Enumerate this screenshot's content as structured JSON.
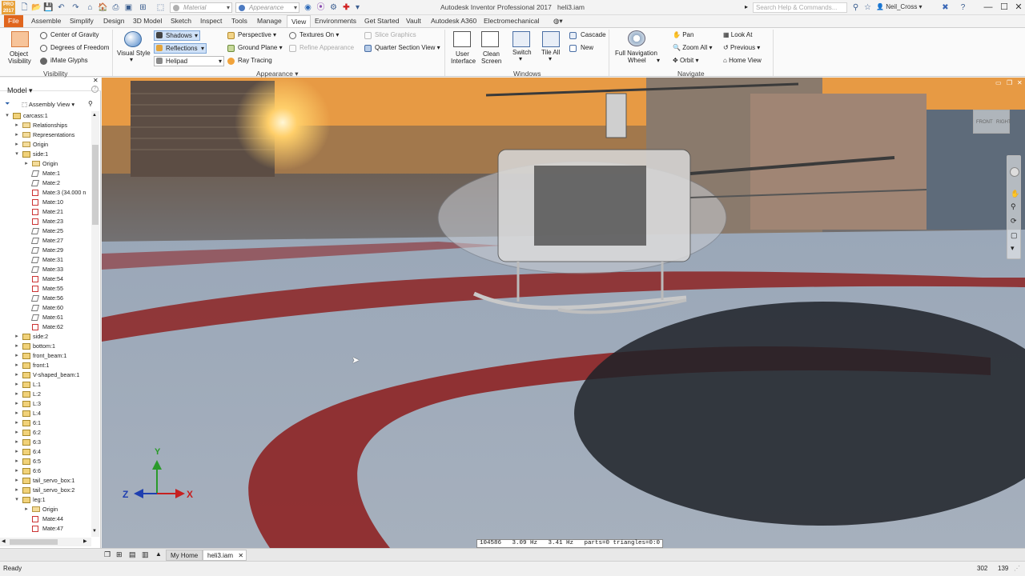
{
  "app": {
    "title": "Autodesk Inventor Professional 2017",
    "filename": "heli3.iam",
    "logo_text": "PRO 2017",
    "material_placeholder": "Material",
    "appearance_placeholder": "Appearance",
    "search_placeholder": "Search Help & Commands...",
    "user": "Neil_Cross"
  },
  "tabs": [
    "File",
    "Assemble",
    "Simplify",
    "Design",
    "3D Model",
    "Sketch",
    "Inspect",
    "Tools",
    "Manage",
    "View",
    "Environments",
    "Get Started",
    "Vault",
    "Autodesk A360",
    "Electromechanical"
  ],
  "active_tab": "View",
  "ribbon": {
    "visibility": {
      "object_visibility": [
        "Object",
        "Visibility"
      ],
      "center_of_gravity": "Center of Gravity",
      "degrees_of_freedom": "Degrees of Freedom",
      "imate_glyphs": "iMate Glyphs",
      "label": "Visibility"
    },
    "appearance": {
      "visual_style": "Visual Style",
      "shadows": "Shadows",
      "reflections": "Reflections",
      "helipad": "Helipad",
      "perspective": "Perspective",
      "ground_plane": "Ground Plane",
      "ray_tracing": "Ray Tracing",
      "textures_on": "Textures On",
      "refine_appearance": "Refine Appearance",
      "label": "Appearance"
    },
    "section": {
      "slice_graphics": "Slice Graphics",
      "quarter_section": "Quarter Section View"
    },
    "windows": {
      "user_interface": [
        "User",
        "Interface"
      ],
      "clean_screen": [
        "Clean",
        "Screen"
      ],
      "switch": "Switch",
      "tile_all": "Tile All",
      "cascade": "Cascade",
      "new": "New",
      "label": "Windows"
    },
    "navigate": {
      "full_nav_wheel": [
        "Full Navigation",
        "Wheel"
      ],
      "pan": "Pan",
      "zoom_all": "Zoom All",
      "orbit": "Orbit",
      "look_at": "Look At",
      "previous": "Previous",
      "home_view": "Home View",
      "label": "Navigate"
    }
  },
  "browser": {
    "title": "Model",
    "view": "Assembly View",
    "tree": [
      {
        "label": "carcass:1",
        "indent": 0,
        "arrow": "▾",
        "icon": "asm"
      },
      {
        "label": "Relationships",
        "indent": 1,
        "arrow": "▸",
        "icon": "folder"
      },
      {
        "label": "Representations",
        "indent": 1,
        "arrow": "▸",
        "icon": "folder"
      },
      {
        "label": "Origin",
        "indent": 1,
        "arrow": "▸",
        "icon": "folder"
      },
      {
        "label": "side:1",
        "indent": 1,
        "arrow": "▾",
        "icon": "asm"
      },
      {
        "label": "Origin",
        "indent": 2,
        "arrow": "▸",
        "icon": "folder"
      },
      {
        "label": "Mate:1",
        "indent": 2,
        "arrow": "",
        "icon": "mate"
      },
      {
        "label": "Mate:2",
        "indent": 2,
        "arrow": "",
        "icon": "mate"
      },
      {
        "label": "Mate:3 (34.000 n",
        "indent": 2,
        "arrow": "",
        "icon": "matered"
      },
      {
        "label": "Mate:10",
        "indent": 2,
        "arrow": "",
        "icon": "matered"
      },
      {
        "label": "Mate:21",
        "indent": 2,
        "arrow": "",
        "icon": "matered"
      },
      {
        "label": "Mate:23",
        "indent": 2,
        "arrow": "",
        "icon": "matered"
      },
      {
        "label": "Mate:25",
        "indent": 2,
        "arrow": "",
        "icon": "mate"
      },
      {
        "label": "Mate:27",
        "indent": 2,
        "arrow": "",
        "icon": "mate"
      },
      {
        "label": "Mate:29",
        "indent": 2,
        "arrow": "",
        "icon": "mate"
      },
      {
        "label": "Mate:31",
        "indent": 2,
        "arrow": "",
        "icon": "mate"
      },
      {
        "label": "Mate:33",
        "indent": 2,
        "arrow": "",
        "icon": "mate"
      },
      {
        "label": "Mate:54",
        "indent": 2,
        "arrow": "",
        "icon": "matered"
      },
      {
        "label": "Mate:55",
        "indent": 2,
        "arrow": "",
        "icon": "matered"
      },
      {
        "label": "Mate:56",
        "indent": 2,
        "arrow": "",
        "icon": "mate"
      },
      {
        "label": "Mate:60",
        "indent": 2,
        "arrow": "",
        "icon": "mate"
      },
      {
        "label": "Mate:61",
        "indent": 2,
        "arrow": "",
        "icon": "mate"
      },
      {
        "label": "Mate:62",
        "indent": 2,
        "arrow": "",
        "icon": "matered"
      },
      {
        "label": "side:2",
        "indent": 1,
        "arrow": "▸",
        "icon": "asm"
      },
      {
        "label": "bottom:1",
        "indent": 1,
        "arrow": "▸",
        "icon": "asm"
      },
      {
        "label": "front_beam:1",
        "indent": 1,
        "arrow": "▸",
        "icon": "asm"
      },
      {
        "label": "front:1",
        "indent": 1,
        "arrow": "▸",
        "icon": "asm"
      },
      {
        "label": "V-shaped_beam:1",
        "indent": 1,
        "arrow": "▸",
        "icon": "asm"
      },
      {
        "label": "L:1",
        "indent": 1,
        "arrow": "▸",
        "icon": "asm"
      },
      {
        "label": "L:2",
        "indent": 1,
        "arrow": "▸",
        "icon": "asm"
      },
      {
        "label": "L:3",
        "indent": 1,
        "arrow": "▸",
        "icon": "asm"
      },
      {
        "label": "L:4",
        "indent": 1,
        "arrow": "▸",
        "icon": "asm"
      },
      {
        "label": "6:1",
        "indent": 1,
        "arrow": "▸",
        "icon": "asm"
      },
      {
        "label": "6:2",
        "indent": 1,
        "arrow": "▸",
        "icon": "asm"
      },
      {
        "label": "6:3",
        "indent": 1,
        "arrow": "▸",
        "icon": "asm"
      },
      {
        "label": "6:4",
        "indent": 1,
        "arrow": "▸",
        "icon": "asm"
      },
      {
        "label": "6:5",
        "indent": 1,
        "arrow": "▸",
        "icon": "asm"
      },
      {
        "label": "6:6",
        "indent": 1,
        "arrow": "▸",
        "icon": "asm"
      },
      {
        "label": "tail_servo_box:1",
        "indent": 1,
        "arrow": "▸",
        "icon": "asm"
      },
      {
        "label": "tail_servo_box:2",
        "indent": 1,
        "arrow": "▸",
        "icon": "asm"
      },
      {
        "label": "leg:1",
        "indent": 1,
        "arrow": "▾",
        "icon": "asm"
      },
      {
        "label": "Origin",
        "indent": 2,
        "arrow": "▸",
        "icon": "folder"
      },
      {
        "label": "Mate:44",
        "indent": 2,
        "arrow": "",
        "icon": "matered"
      },
      {
        "label": "Mate:47",
        "indent": 2,
        "arrow": "",
        "icon": "matered"
      }
    ]
  },
  "viewport": {
    "viewcube_front": "FRONT",
    "viewcube_right": "RIGHT",
    "axis_x": "X",
    "axis_y": "Y",
    "axis_z": "Z",
    "stats": "104586   3.09 Hz   3.41 Hz   parts=0 triangles=0:0"
  },
  "doc_tabs": {
    "home": "My Home",
    "file": "heli3.iam"
  },
  "status": {
    "text": "Ready",
    "num1": "302",
    "num2": "139"
  },
  "colors": {
    "file_tab": "#e0651d",
    "helipad_red": "#8e2a2b",
    "sky_orange": "#f3a23b"
  }
}
